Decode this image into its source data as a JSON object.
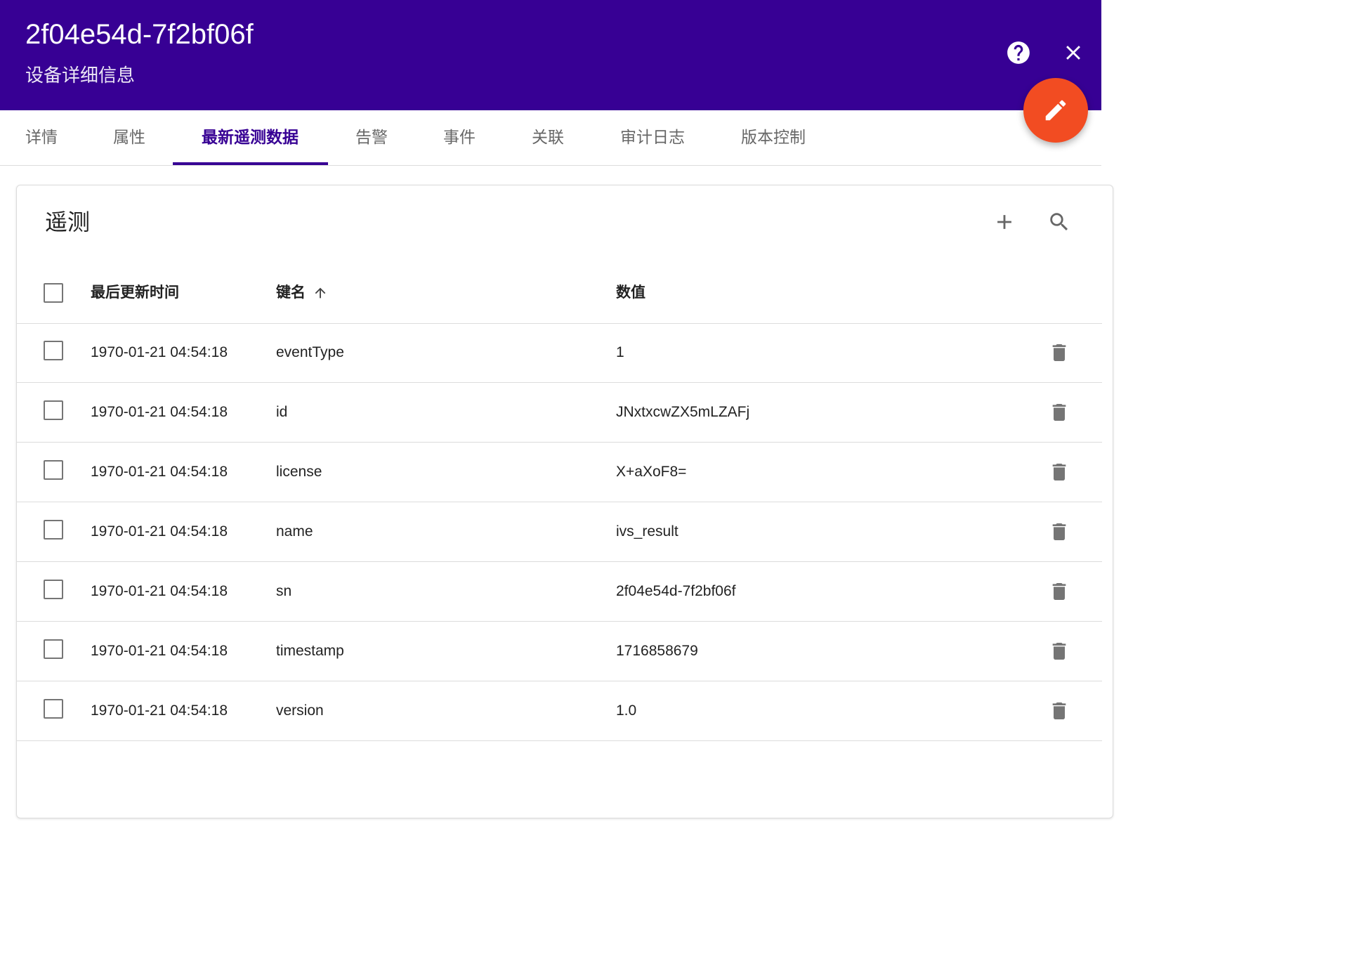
{
  "header": {
    "title": "2f04e54d-7f2bf06f",
    "subtitle": "设备详细信息",
    "help_icon": "help-circle-icon",
    "close_icon": "close-icon",
    "edit_icon": "pencil-icon"
  },
  "tabs": [
    {
      "label": "详情",
      "active": false
    },
    {
      "label": "属性",
      "active": false
    },
    {
      "label": "最新遥测数据",
      "active": true
    },
    {
      "label": "告警",
      "active": false
    },
    {
      "label": "事件",
      "active": false
    },
    {
      "label": "关联",
      "active": false
    },
    {
      "label": "审计日志",
      "active": false
    },
    {
      "label": "版本控制",
      "active": false
    }
  ],
  "telemetry": {
    "title": "遥测",
    "add_icon": "plus-icon",
    "search_icon": "search-icon",
    "columns": {
      "time": "最后更新时间",
      "key": "键名",
      "value": "数值"
    },
    "sort": {
      "column": "key",
      "direction": "asc"
    },
    "rows": [
      {
        "time": "1970-01-21 04:54:18",
        "key": "eventType",
        "value": "1"
      },
      {
        "time": "1970-01-21 04:54:18",
        "key": "id",
        "value": "JNxtxcwZX5mLZAFj"
      },
      {
        "time": "1970-01-21 04:54:18",
        "key": "license",
        "value": "X+aXoF8="
      },
      {
        "time": "1970-01-21 04:54:18",
        "key": "name",
        "value": "ivs_result"
      },
      {
        "time": "1970-01-21 04:54:18",
        "key": "sn",
        "value": "2f04e54d-7f2bf06f"
      },
      {
        "time": "1970-01-21 04:54:18",
        "key": "timestamp",
        "value": "1716858679"
      },
      {
        "time": "1970-01-21 04:54:18",
        "key": "version",
        "value": "1.0"
      }
    ]
  },
  "colors": {
    "header_bg": "#370094",
    "fab_bg": "#f24c22",
    "active_tab": "#370094"
  }
}
